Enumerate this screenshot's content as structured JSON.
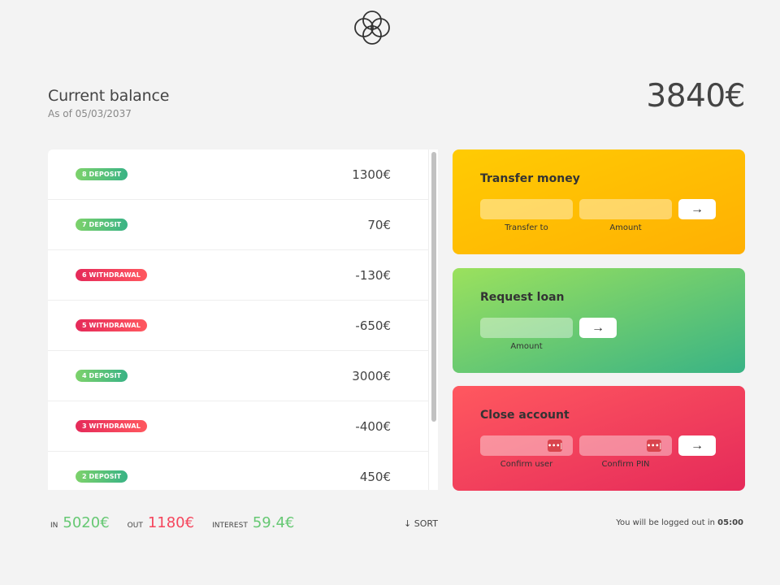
{
  "header": {
    "logo_icon": "flower-logo-icon"
  },
  "balance": {
    "title": "Current balance",
    "date_prefix": "As of",
    "date": "05/03/2037",
    "value": "3840€"
  },
  "movements": [
    {
      "label": "8 deposit",
      "type": "deposit",
      "value": "1300€"
    },
    {
      "label": "7 deposit",
      "type": "deposit",
      "value": "70€"
    },
    {
      "label": "6 withdrawal",
      "type": "withdrawal",
      "value": "-130€"
    },
    {
      "label": "5 withdrawal",
      "type": "withdrawal",
      "value": "-650€"
    },
    {
      "label": "4 deposit",
      "type": "deposit",
      "value": "3000€"
    },
    {
      "label": "3 withdrawal",
      "type": "withdrawal",
      "value": "-400€"
    },
    {
      "label": "2 deposit",
      "type": "deposit",
      "value": "450€"
    }
  ],
  "operations": {
    "transfer": {
      "title": "Transfer money",
      "label_to": "Transfer to",
      "label_amount": "Amount",
      "button": "→"
    },
    "loan": {
      "title": "Request loan",
      "label_amount": "Amount",
      "button": "→"
    },
    "close": {
      "title": "Close account",
      "label_user": "Confirm user",
      "label_pin": "Confirm PIN",
      "button": "→",
      "key_icon": "•••|"
    }
  },
  "summary": {
    "in_label": "IN",
    "in_value": "5020€",
    "out_label": "OUT",
    "out_value": "1180€",
    "interest_label": "INTEREST",
    "interest_value": "59.4€",
    "sort_label": "↓ SORT"
  },
  "logout": {
    "text": "You will be logged out in",
    "timer": "05:00"
  },
  "colors": {
    "deposit": "#66c873",
    "withdrawal": "#f5465d",
    "transfer": "#ffb003",
    "loan": "#39b385",
    "close": "#e52a5a"
  }
}
